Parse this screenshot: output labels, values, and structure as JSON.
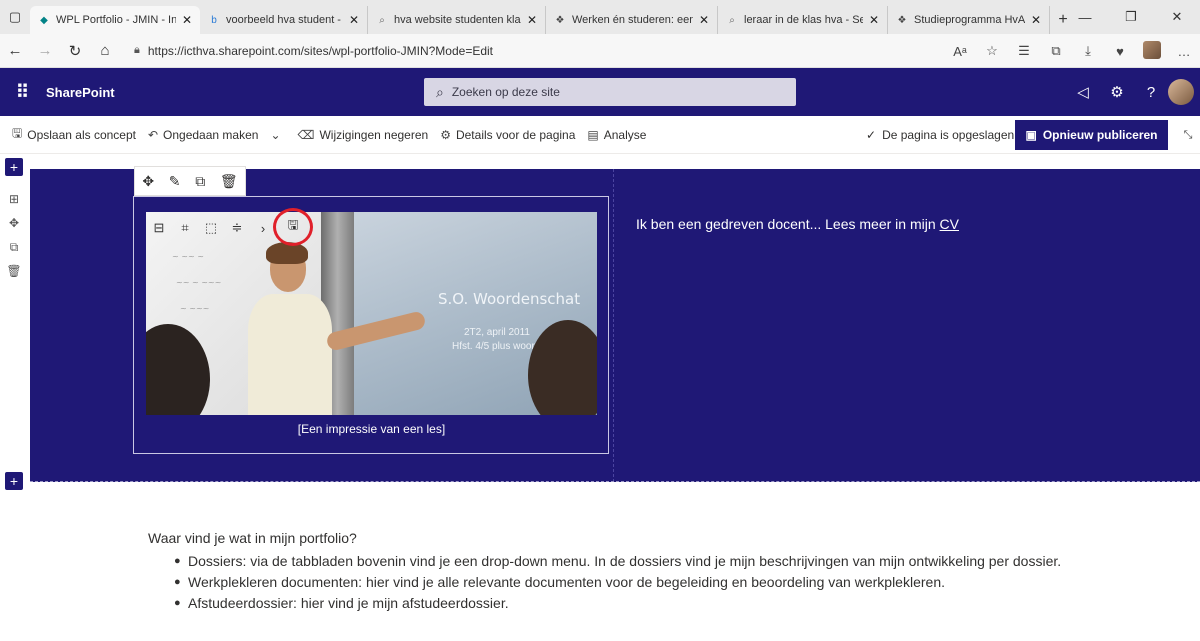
{
  "browser": {
    "tabs": [
      {
        "title": "WPL Portfolio - JMIN - Intro",
        "active": true,
        "favicon": "sharepoint-icon"
      },
      {
        "title": "voorbeeld hva student - Bin",
        "active": false,
        "favicon": "bing-icon"
      },
      {
        "title": "hva website studenten klas",
        "active": false,
        "favicon": "search-icon"
      },
      {
        "title": "Werken én studeren: een op",
        "active": false,
        "favicon": "hva-icon"
      },
      {
        "title": "leraar in de klas hva - Searc",
        "active": false,
        "favicon": "search-icon"
      },
      {
        "title": "Studieprogramma HvA Lera",
        "active": false,
        "favicon": "hva-icon"
      }
    ],
    "url": "https://icthva.sharepoint.com/sites/wpl-portfolio-JMIN?Mode=Edit"
  },
  "suitebar": {
    "brand": "SharePoint",
    "search_placeholder": "Zoeken op deze site"
  },
  "commandbar": {
    "save_draft": "Opslaan als concept",
    "undo": "Ongedaan maken",
    "discard": "Wijzigingen negeren",
    "page_details": "Details voor de pagina",
    "analytics": "Analyse",
    "saved_status": "De pagina is opgeslagen",
    "republish": "Opnieuw publiceren"
  },
  "hero": {
    "caption": "[Een impressie van een les]",
    "text_prefix": "Ik ben een gedreven docent... Lees meer in mijn",
    "cv_link": "CV",
    "slide_title": "S.O. Woordenschat",
    "slide_line1": "2T2, april 2011",
    "slide_line2": "Hfst. 4/5 plus woorden"
  },
  "content": {
    "heading": "Waar vind je wat in mijn portfolio?",
    "bullets": [
      "Dossiers: via de tabbladen bovenin vind je een drop-down menu. In de dossiers vind je mijn beschrijvingen van mijn ontwikkeling per dossier.",
      "Werkplekleren documenten: hier vind je alle relevante documenten voor de begeleiding en beoordeling van werkplekleren.",
      "Afstudeerdossier: hier vind je mijn afstudeerdossier."
    ]
  },
  "colors": {
    "brand": "#1f1876",
    "highlight_circle": "#e0202a"
  }
}
